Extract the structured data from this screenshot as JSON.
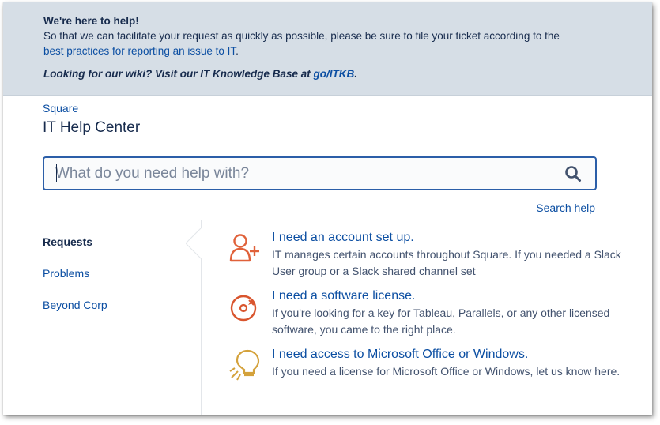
{
  "banner": {
    "title": "We're here to help!",
    "message": "So that we can facilitate your request as quickly as possible, please be sure to file your ticket according to the",
    "link": "best practices for reporting an issue to IT",
    "link_suffix": ".",
    "wiki_text": "Looking for our wiki? Visit our IT Knowledge Base at ",
    "wiki_link": "go/ITKB",
    "wiki_suffix": "."
  },
  "breadcrumb": "Square",
  "page_title": "IT Help Center",
  "search": {
    "placeholder": "What do you need help with?",
    "icon": "search-icon"
  },
  "search_help": "Search help",
  "nav": {
    "items": [
      {
        "label": "Requests",
        "active": true
      },
      {
        "label": "Problems",
        "active": false
      },
      {
        "label": "Beyond Corp",
        "active": false
      }
    ]
  },
  "requests": [
    {
      "title": "I need an account set up.",
      "description": "IT manages certain accounts throughout Square. If you needed a  Slack User group or a Slack shared channel set",
      "icon": "add-user-icon",
      "color": "#e0613a"
    },
    {
      "title": "I need a software license.",
      "description": "If you're looking for a key for Tableau, Parallels, or any other licensed software, you came to the right place.",
      "icon": "disc-icon",
      "color": "#d9552e"
    },
    {
      "title": "I need access to Microsoft Office or Windows.",
      "description": "If you need a license for Microsoft Office or Windows, let us know here.",
      "icon": "lightbulb-icon",
      "color": "#d4a23c"
    }
  ],
  "colors": {
    "banner_bg": "#d6dee6",
    "link": "#0b4ea2",
    "text": "#172b4d"
  }
}
